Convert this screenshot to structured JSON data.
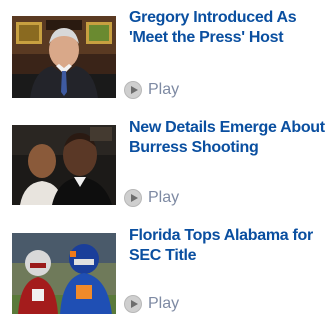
{
  "items": [
    {
      "headline": "Gregory Introduced As 'Meet the Press' Host",
      "play_label": "Play",
      "thumbnail": "news-anchor-photo"
    },
    {
      "headline": "New Details Emerge About Burress Shooting",
      "play_label": "Play",
      "thumbnail": "burress-photo"
    },
    {
      "headline": "Florida Tops Alabama for SEC Title",
      "play_label": "Play",
      "thumbnail": "football-players-photo"
    }
  ],
  "colors": {
    "headline": "#0a4fa0",
    "play_text": "#7e8aa3",
    "play_icon_bg": "#cfcfcf"
  },
  "icons": {
    "play": "play-icon"
  }
}
